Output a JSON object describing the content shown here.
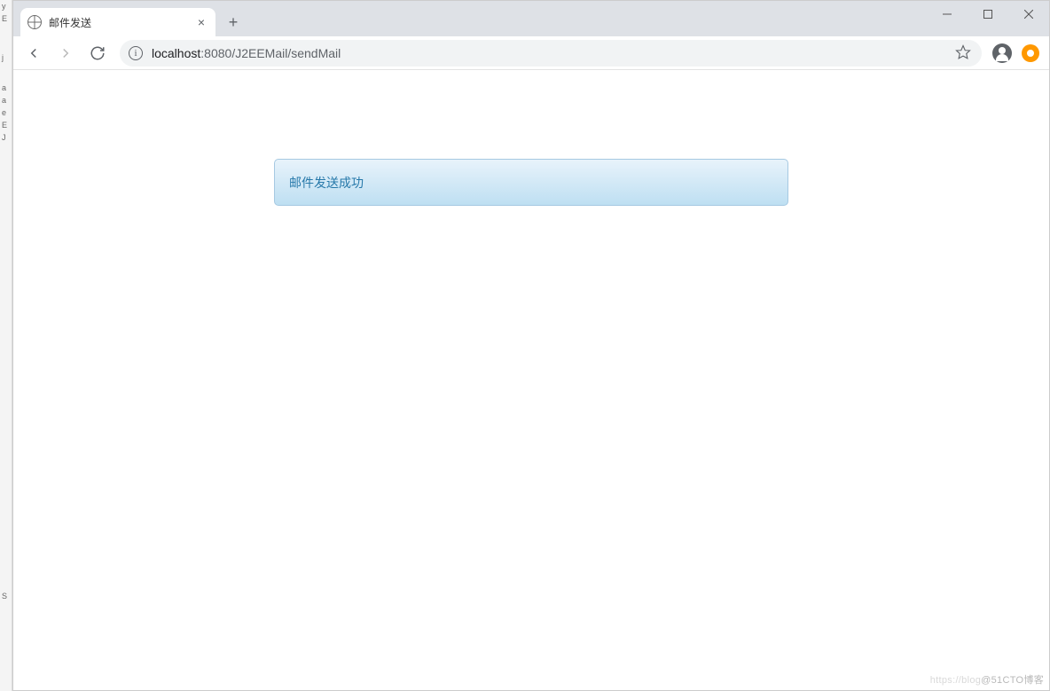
{
  "left_strip_chars": [
    "y",
    "E",
    " ",
    "j",
    " ",
    "a",
    "a",
    "e",
    "E",
    "J",
    " ",
    " ",
    " ",
    " ",
    " ",
    " ",
    " ",
    " ",
    " ",
    " ",
    " ",
    " ",
    " ",
    " ",
    " ",
    " ",
    " ",
    " ",
    " ",
    " ",
    " ",
    " ",
    " ",
    " ",
    " ",
    " ",
    " ",
    " ",
    " ",
    " ",
    " ",
    " ",
    " ",
    " ",
    " ",
    " ",
    " ",
    "S"
  ],
  "tab": {
    "title": "邮件发送"
  },
  "address": {
    "host": "localhost",
    "port": ":8080",
    "path": "/J2EEMail/sendMail"
  },
  "info_icon_label": "i",
  "message": "邮件发送成功",
  "watermark_prefix": "https://blog",
  "watermark_suffix": "@51CTO博客"
}
